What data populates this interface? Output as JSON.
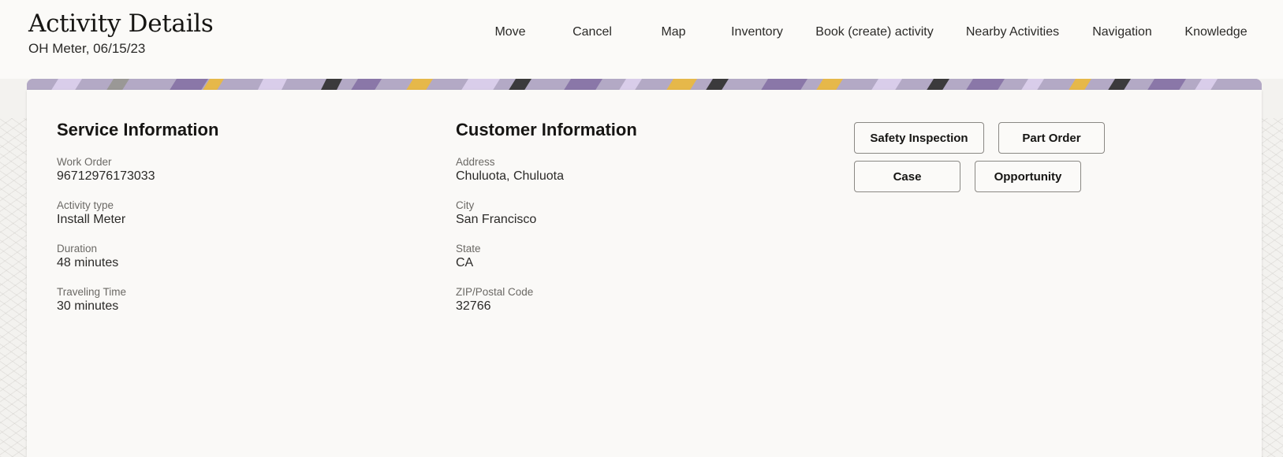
{
  "header": {
    "title": "Activity Details",
    "subtitle": "OH Meter, 06/15/23"
  },
  "nav": {
    "items": [
      "Move",
      "Cancel",
      "Map",
      "Inventory",
      "Book (create) activity",
      "Nearby Activities",
      "Navigation",
      "Knowledge"
    ]
  },
  "service": {
    "title": "Service Information",
    "fields": [
      {
        "label": "Work Order",
        "value": "96712976173033"
      },
      {
        "label": "Activity type",
        "value": "Install Meter"
      },
      {
        "label": "Duration",
        "value": "48 minutes"
      },
      {
        "label": "Traveling Time",
        "value": "30 minutes"
      }
    ]
  },
  "customer": {
    "title": "Customer Information",
    "fields": [
      {
        "label": "Address",
        "value": "Chuluota, Chuluota"
      },
      {
        "label": "City",
        "value": "San Francisco"
      },
      {
        "label": "State",
        "value": "CA"
      },
      {
        "label": "ZIP/Postal Code",
        "value": "32766"
      }
    ]
  },
  "actions": {
    "safety_inspection": "Safety Inspection",
    "part_order": "Part Order",
    "case": "Case",
    "opportunity": "Opportunity"
  },
  "colors": {
    "banner_purple": "#8a77a8",
    "banner_lilac": "#d9cdea",
    "banner_gold": "#e6b84a",
    "banner_charcoal": "#3b3a3c"
  }
}
